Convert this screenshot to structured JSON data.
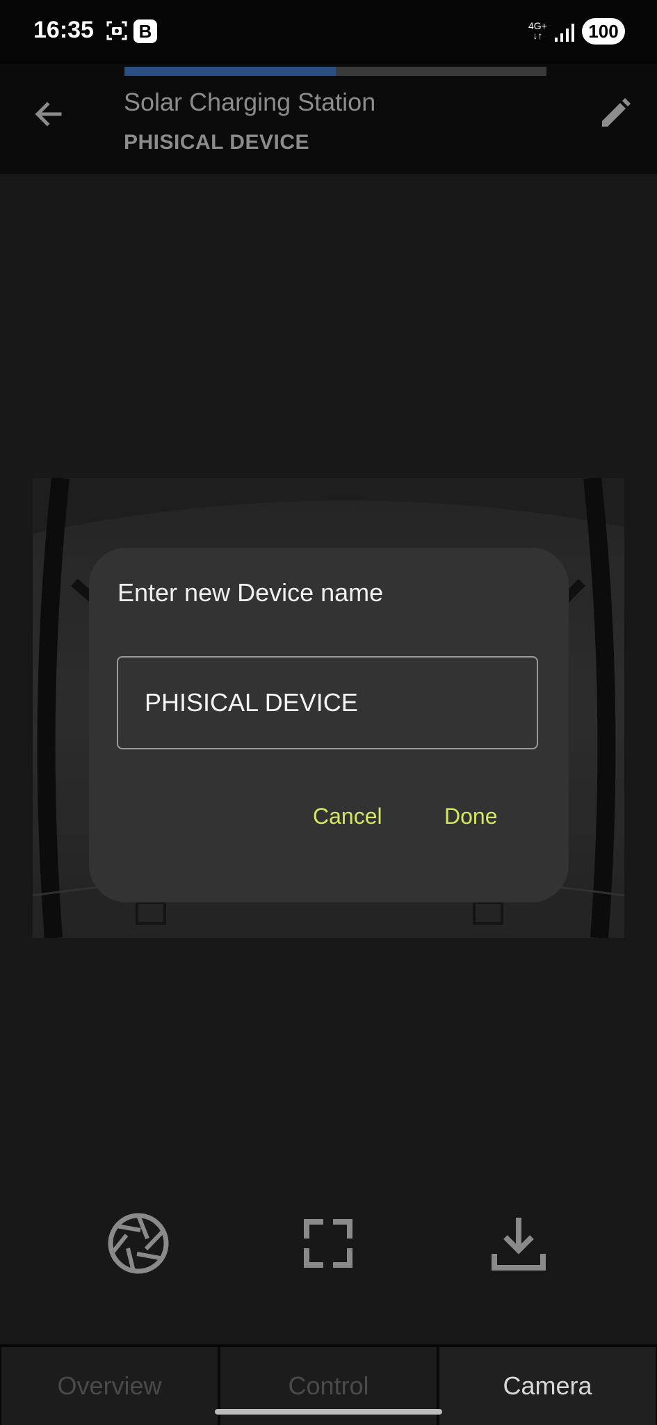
{
  "status_bar": {
    "time": "16:35",
    "b_badge": "B",
    "network_label": "4G+",
    "battery": "100"
  },
  "header": {
    "title": "Solar Charging Station",
    "subtitle": "PHISICAL DEVICE",
    "progress_fraction": 0.5,
    "progress_color": "#2b4f80",
    "back_icon": "arrow-left-icon",
    "edit_icon": "pencil-icon"
  },
  "dialog": {
    "title": "Enter new Device name",
    "input_value": "PHISICAL DEVICE",
    "cancel_label": "Cancel",
    "done_label": "Done",
    "accent_color": "#d7e75e"
  },
  "controls": {
    "shutter_icon": "camera-shutter-icon",
    "fullscreen_icon": "fullscreen-icon",
    "download_icon": "download-icon"
  },
  "tabs": [
    {
      "label": "Overview",
      "active": false
    },
    {
      "label": "Control",
      "active": false
    },
    {
      "label": "Camera",
      "active": true
    }
  ]
}
